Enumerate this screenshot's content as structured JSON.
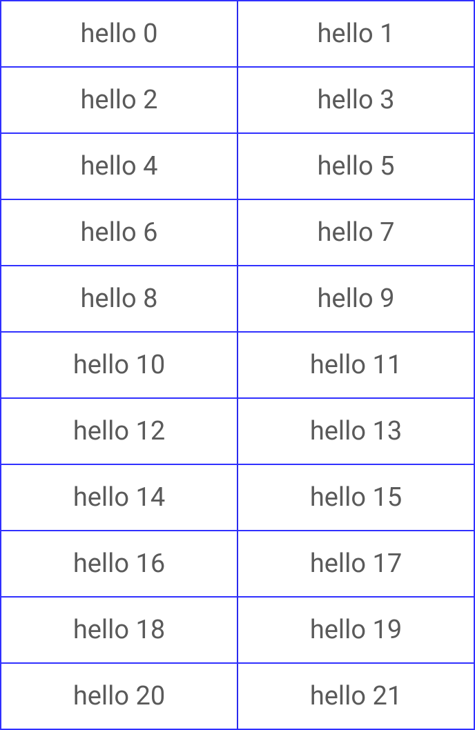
{
  "grid": {
    "items": [
      {
        "label": "hello 0"
      },
      {
        "label": "hello 1"
      },
      {
        "label": "hello 2"
      },
      {
        "label": "hello 3"
      },
      {
        "label": "hello 4"
      },
      {
        "label": "hello 5"
      },
      {
        "label": "hello 6"
      },
      {
        "label": "hello 7"
      },
      {
        "label": "hello 8"
      },
      {
        "label": "hello 9"
      },
      {
        "label": "hello 10"
      },
      {
        "label": "hello 11"
      },
      {
        "label": "hello 12"
      },
      {
        "label": "hello 13"
      },
      {
        "label": "hello 14"
      },
      {
        "label": "hello 15"
      },
      {
        "label": "hello 16"
      },
      {
        "label": "hello 17"
      },
      {
        "label": "hello 18"
      },
      {
        "label": "hello 19"
      },
      {
        "label": "hello 20"
      },
      {
        "label": "hello 21"
      }
    ]
  },
  "colors": {
    "border": "#3030ff",
    "text": "#5a5a5a",
    "background": "#ffffff"
  }
}
